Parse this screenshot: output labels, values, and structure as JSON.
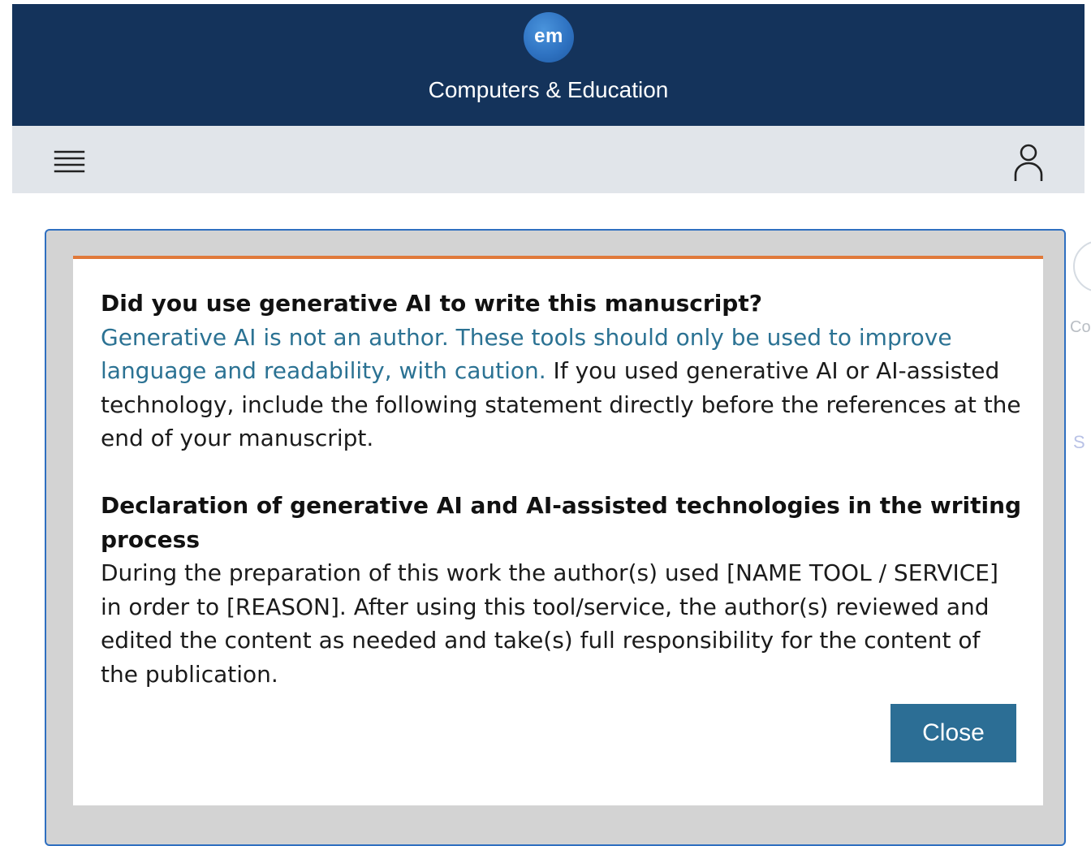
{
  "header": {
    "logo_text": "em",
    "journal_title": "Computers & Education",
    "bg_color": "#14335b"
  },
  "toolbar": {
    "menu_icon": "hamburger-menu-icon",
    "user_icon": "user-account-icon"
  },
  "background_fragments": {
    "text_co": "Co",
    "text_s": "S"
  },
  "modal": {
    "accent_color": "#e0793a",
    "link_color": "#2b7293",
    "question_heading": "Did you use generative AI to write this manuscript?",
    "notice_link": "Generative AI is not an author. These tools should only be used to improve language and readability, with caution.",
    "notice_text": " If you used generative AI or AI-assisted technology, include the following statement directly before the references at the end of your manuscript.",
    "declaration_heading": "Declaration of generative AI and AI-assisted technologies in the writing process",
    "declaration_text": "During the preparation of this work the author(s) used [NAME TOOL / SERVICE] in order to [REASON]. After using this tool/service, the author(s) reviewed and edited the content as needed and take(s) full responsibility for the content of the publication.",
    "close_label": "Close",
    "close_color": "#2c6e95"
  }
}
